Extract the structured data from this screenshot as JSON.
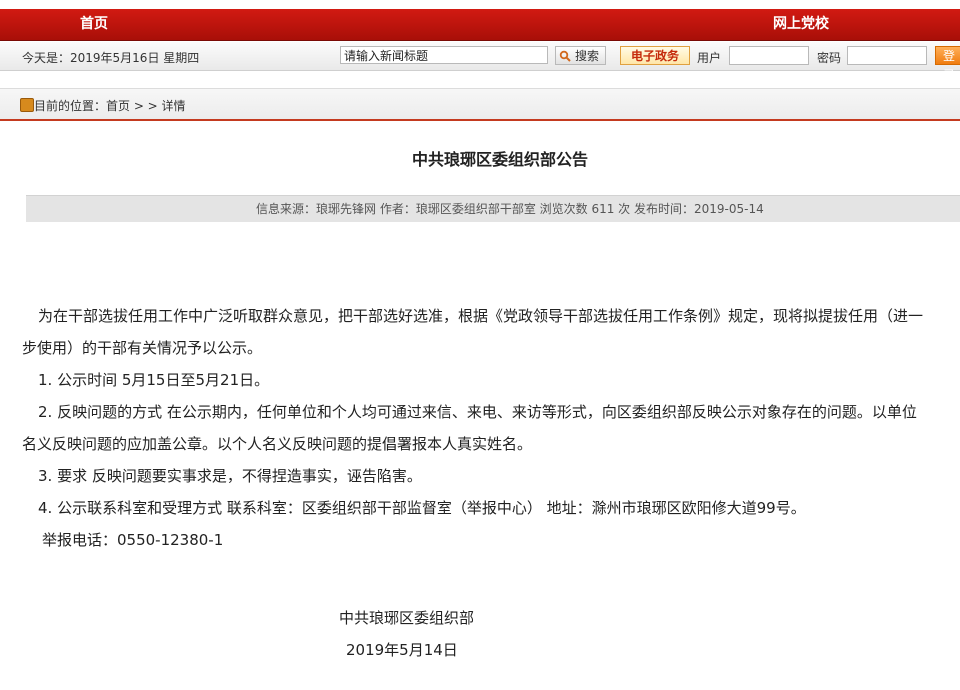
{
  "nav": {
    "home": "首页",
    "party_school": "网上党校"
  },
  "infobar": {
    "date": "今天是：2019年5月16日 星期四",
    "search_value": "请输入新闻标题",
    "search_button": "搜索",
    "egov_label": "电子政务",
    "user_label": "用户",
    "password_label": "密码",
    "login_button": "登录"
  },
  "breadcrumb": {
    "text": "目前的位置：首页 > > 详情"
  },
  "article": {
    "title": "中共琅琊区委组织部公告",
    "meta": "信息来源：琅琊先锋网 作者：琅琊区委组织部干部室 浏览次数 611 次 发布时间：2019-05-14",
    "para1_line1": "为在干部选拔任用工作中广泛听取群众意见，把干部选好选准，根据《党政领导干部选拔任用工作条例》规定，现将拟提拔任用（进一",
    "para1_line2": "步使用）的干部有关情况予以公示。",
    "item1": "1. 公示时间  5月15日至5月21日。",
    "item2_line1": "2. 反映问题的方式  在公示期内，任何单位和个人均可通过来信、来电、来访等形式，向区委组织部反映公示对象存在的问题。以单位",
    "item2_line2": "名义反映问题的应加盖公章。以个人名义反映问题的提倡署报本人真实姓名。",
    "item3": "3. 要求  反映问题要实事求是，不得捏造事实，诬告陷害。",
    "item4": "4. 公示联系科室和受理方式  联系科室：区委组织部干部监督室（举报中心） 地址：滁州市琅琊区欧阳修大道99号。",
    "phone": "举报电话：0550-12380-1",
    "signer": "中共琅琊区委组织部",
    "sign_date": "2019年5月14日"
  }
}
